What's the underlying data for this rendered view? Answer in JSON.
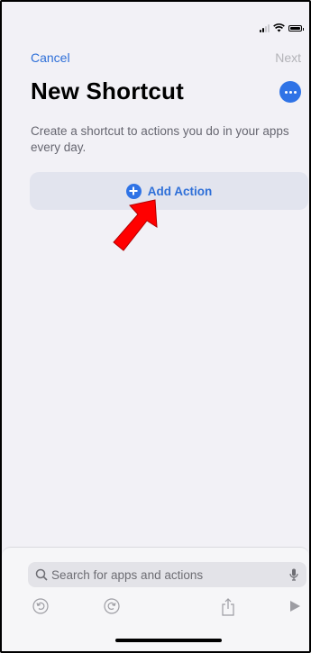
{
  "status_bar": {
    "signal_icon": "signal-icon",
    "wifi_icon": "wifi-icon",
    "battery_icon": "battery-icon"
  },
  "nav": {
    "cancel_label": "Cancel",
    "next_label": "Next"
  },
  "title": "New Shortcut",
  "more_icon": "ellipsis-circle-icon",
  "description": "Create a shortcut to actions you do in your apps every day.",
  "add_action": {
    "label": "Add Action",
    "icon": "plus-circle-icon"
  },
  "annotation": {
    "icon": "red-arrow-icon",
    "color": "#ff0000"
  },
  "bottom": {
    "search_placeholder": "Search for apps and actions",
    "search_icon": "search-icon",
    "mic_icon": "microphone-icon",
    "toolbar": [
      "undo-icon",
      "redo-icon",
      "share-icon",
      "play-icon"
    ]
  },
  "colors": {
    "accent": "#2e6fd8",
    "background": "#f2f1f6"
  }
}
